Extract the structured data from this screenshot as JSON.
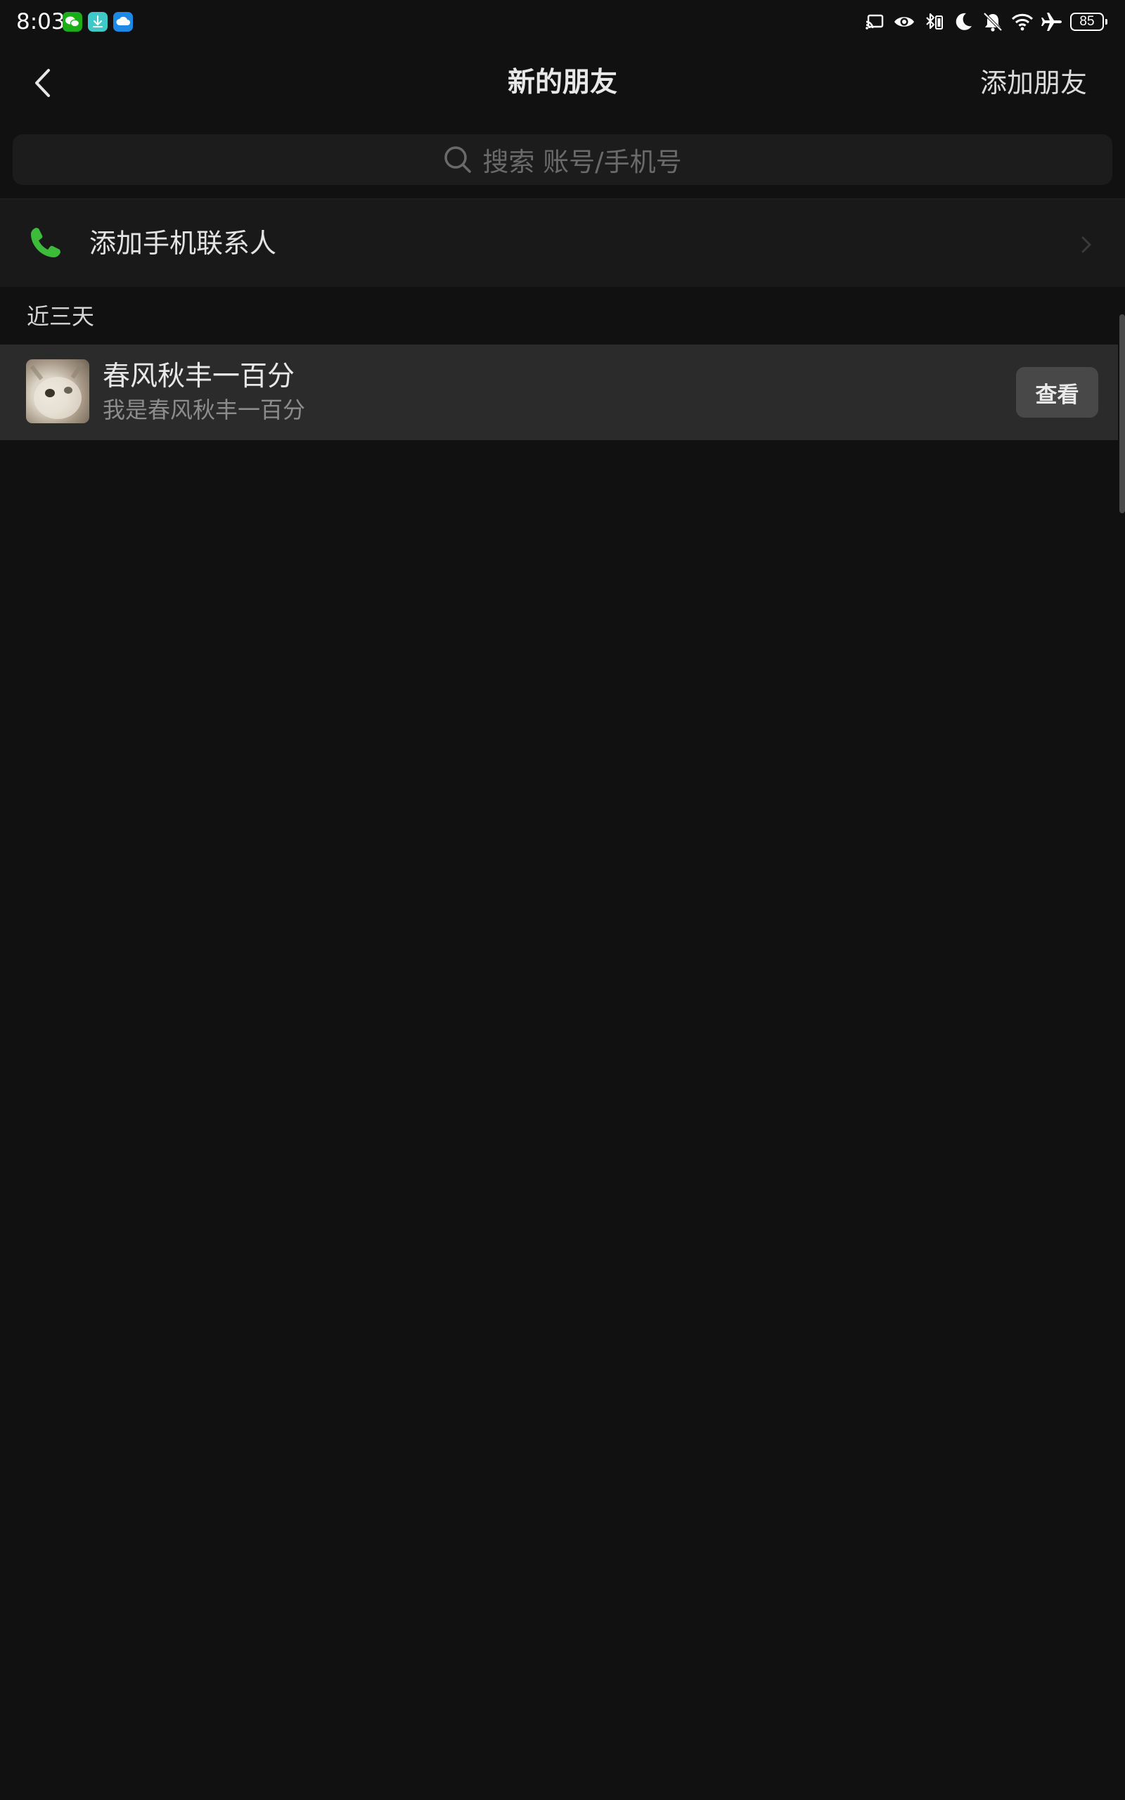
{
  "status_bar": {
    "time": "8:03",
    "app_icons": [
      "wechat-icon",
      "download-icon",
      "cloud-icon"
    ],
    "system_icons": [
      "cast-icon",
      "eye-icon",
      "bluetooth-icon",
      "moon-icon",
      "bell-off-icon",
      "wifi-icon",
      "airplane-icon"
    ],
    "battery": "85"
  },
  "nav": {
    "title": "新的朋友",
    "action": "添加朋友"
  },
  "search": {
    "placeholder": "搜索 账号/手机号"
  },
  "add_contacts": {
    "label": "添加手机联系人"
  },
  "section": {
    "label": "近三天"
  },
  "friends": [
    {
      "name": "春风秋丰一百分",
      "message": "我是春风秋丰一百分",
      "button": "查看"
    }
  ],
  "colors": {
    "background": "#111111",
    "accent_green": "#3dbb3a",
    "row_bg": "#191919",
    "highlight_row_bg": "#2b2b2b"
  }
}
